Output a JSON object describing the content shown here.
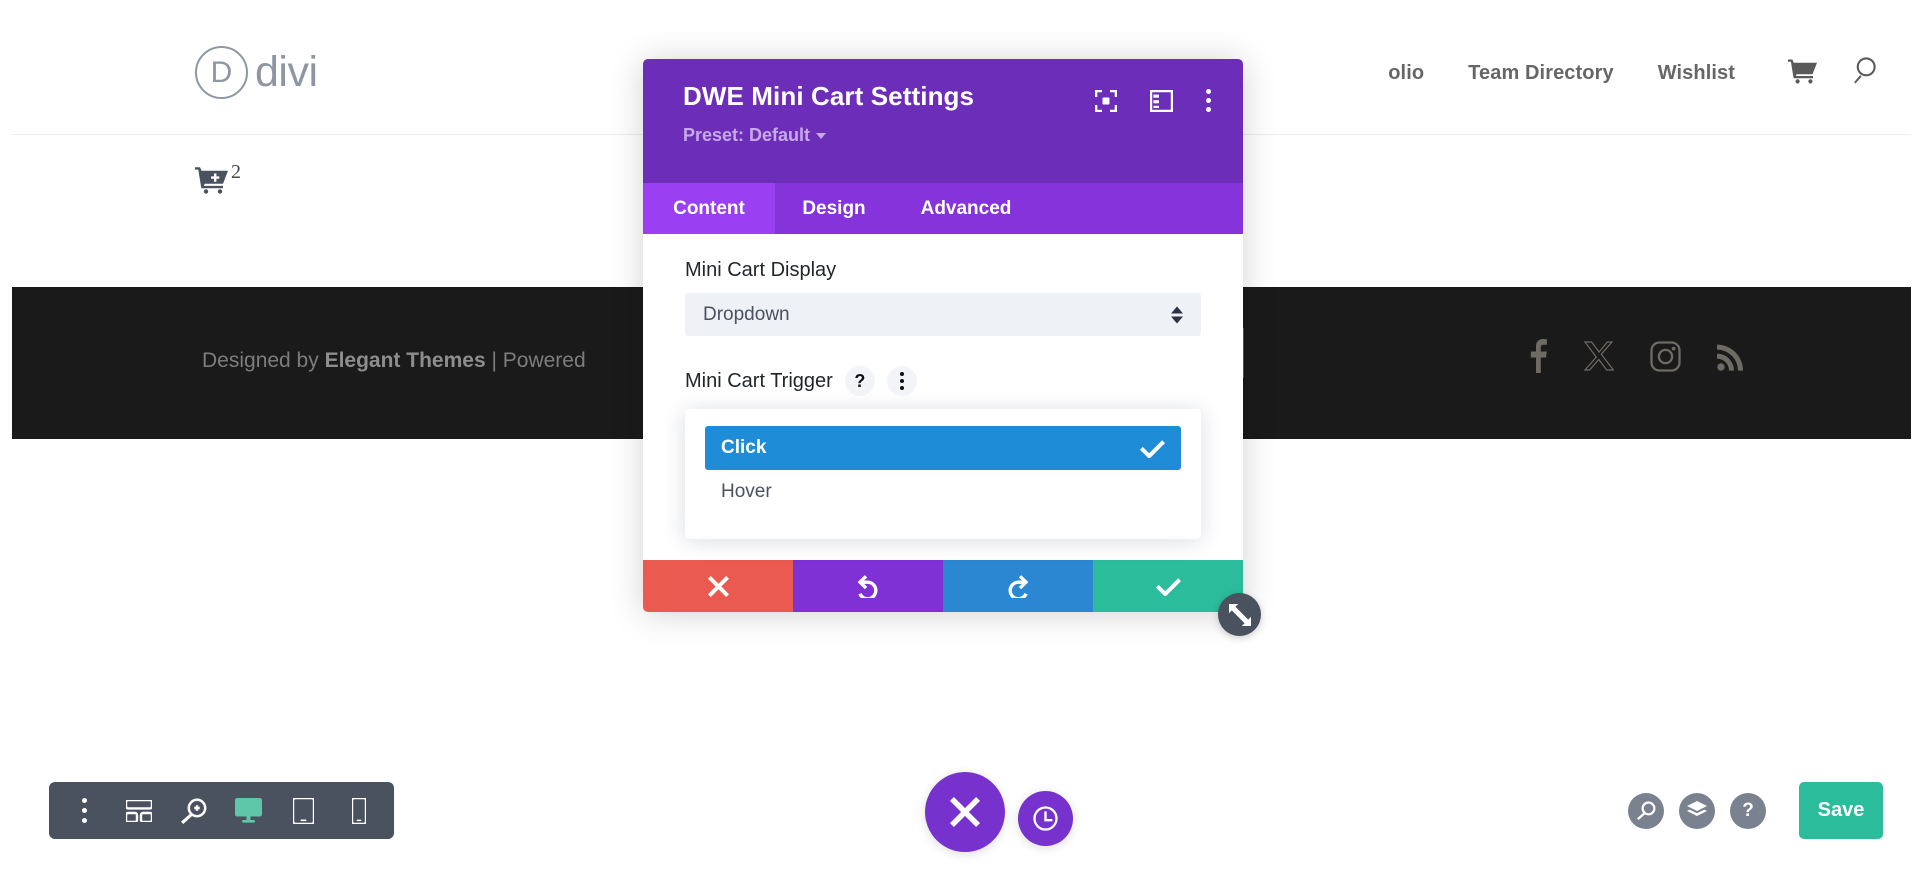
{
  "site": {
    "brand": {
      "mark_letter": "D",
      "word": "divi"
    },
    "nav_items": [
      {
        "label": "olio",
        "name": "nav-portfolio"
      },
      {
        "label": "Team Directory",
        "name": "nav-team-directory"
      },
      {
        "label": "Wishlist",
        "name": "nav-wishlist"
      }
    ],
    "nav_icons": [
      {
        "icon": "cart-icon",
        "name": "header-cart-icon"
      },
      {
        "icon": "search-icon",
        "name": "header-search-icon"
      }
    ],
    "minicart_widget": {
      "icon": "cart-plus-icon",
      "count": "2"
    },
    "footer": {
      "credit_prefix": "Designed by ",
      "credit_brand": "Elegant Themes",
      "credit_suffix": " | Powered",
      "social": [
        {
          "icon": "facebook-icon",
          "name": "social-facebook"
        },
        {
          "icon": "x-twitter-icon",
          "name": "social-x-twitter"
        },
        {
          "icon": "instagram-icon",
          "name": "social-instagram"
        },
        {
          "icon": "rss-icon",
          "name": "social-rss"
        }
      ]
    }
  },
  "modal": {
    "title": "DWE Mini Cart Settings",
    "preset_label": "Preset: Default",
    "header_tools": [
      {
        "icon": "focus-expand-icon",
        "name": "modal-focus-button"
      },
      {
        "icon": "panel-layout-icon",
        "name": "modal-layout-button"
      },
      {
        "icon": "kebab-menu-icon",
        "name": "modal-more-button"
      }
    ],
    "tabs": [
      {
        "label": "Content",
        "active": true
      },
      {
        "label": "Design",
        "active": false
      },
      {
        "label": "Advanced",
        "active": false
      }
    ],
    "fields": {
      "display": {
        "label": "Mini Cart Display",
        "value": "Dropdown",
        "options": [
          "Dropdown"
        ]
      },
      "trigger": {
        "label": "Mini Cart Trigger",
        "help_icon": "?",
        "options": [
          {
            "label": "Click",
            "selected": true
          },
          {
            "label": "Hover",
            "selected": false
          }
        ]
      }
    },
    "footer_buttons": [
      {
        "icon": "close-x-icon",
        "name": "modal-discard-button"
      },
      {
        "icon": "undo-icon",
        "name": "modal-undo-button"
      },
      {
        "icon": "redo-icon",
        "name": "modal-redo-button"
      },
      {
        "icon": "check-icon",
        "name": "modal-save-button"
      }
    ],
    "resize_handle_icon": "resize-diagonal-icon"
  },
  "builder": {
    "toolbar": [
      {
        "icon": "kebab-menu-icon",
        "name": "builder-menu-button",
        "active": false
      },
      {
        "icon": "wireframe-icon",
        "name": "builder-wireframe-button",
        "active": false
      },
      {
        "icon": "zoom-out-icon",
        "name": "builder-zoom-button",
        "active": false
      },
      {
        "icon": "desktop-icon",
        "name": "builder-desktop-view",
        "active": true
      },
      {
        "icon": "tablet-icon",
        "name": "builder-tablet-view",
        "active": false
      },
      {
        "icon": "phone-icon",
        "name": "builder-phone-view",
        "active": false
      }
    ],
    "center": [
      {
        "icon": "close-x-icon",
        "name": "builder-close-button"
      },
      {
        "icon": "history-clock-icon",
        "name": "builder-history-button"
      }
    ],
    "right": [
      {
        "icon": "search-icon",
        "name": "builder-search-button"
      },
      {
        "icon": "layers-icon",
        "name": "builder-layers-button"
      },
      {
        "icon": "help-icon",
        "label": "?",
        "name": "builder-help-button"
      }
    ],
    "save_label": "Save"
  },
  "colors": {
    "modal_header": "#6C2EB9",
    "tab_bar": "#8533DB",
    "tab_active": "#9A3FF2",
    "accent_blue": "#1E8CD6",
    "teal": "#2BBC9B",
    "red": "#EB5A51",
    "purple": "#8031D6",
    "slate": "#4A5260",
    "footer_dark": "#1A1A1A"
  }
}
